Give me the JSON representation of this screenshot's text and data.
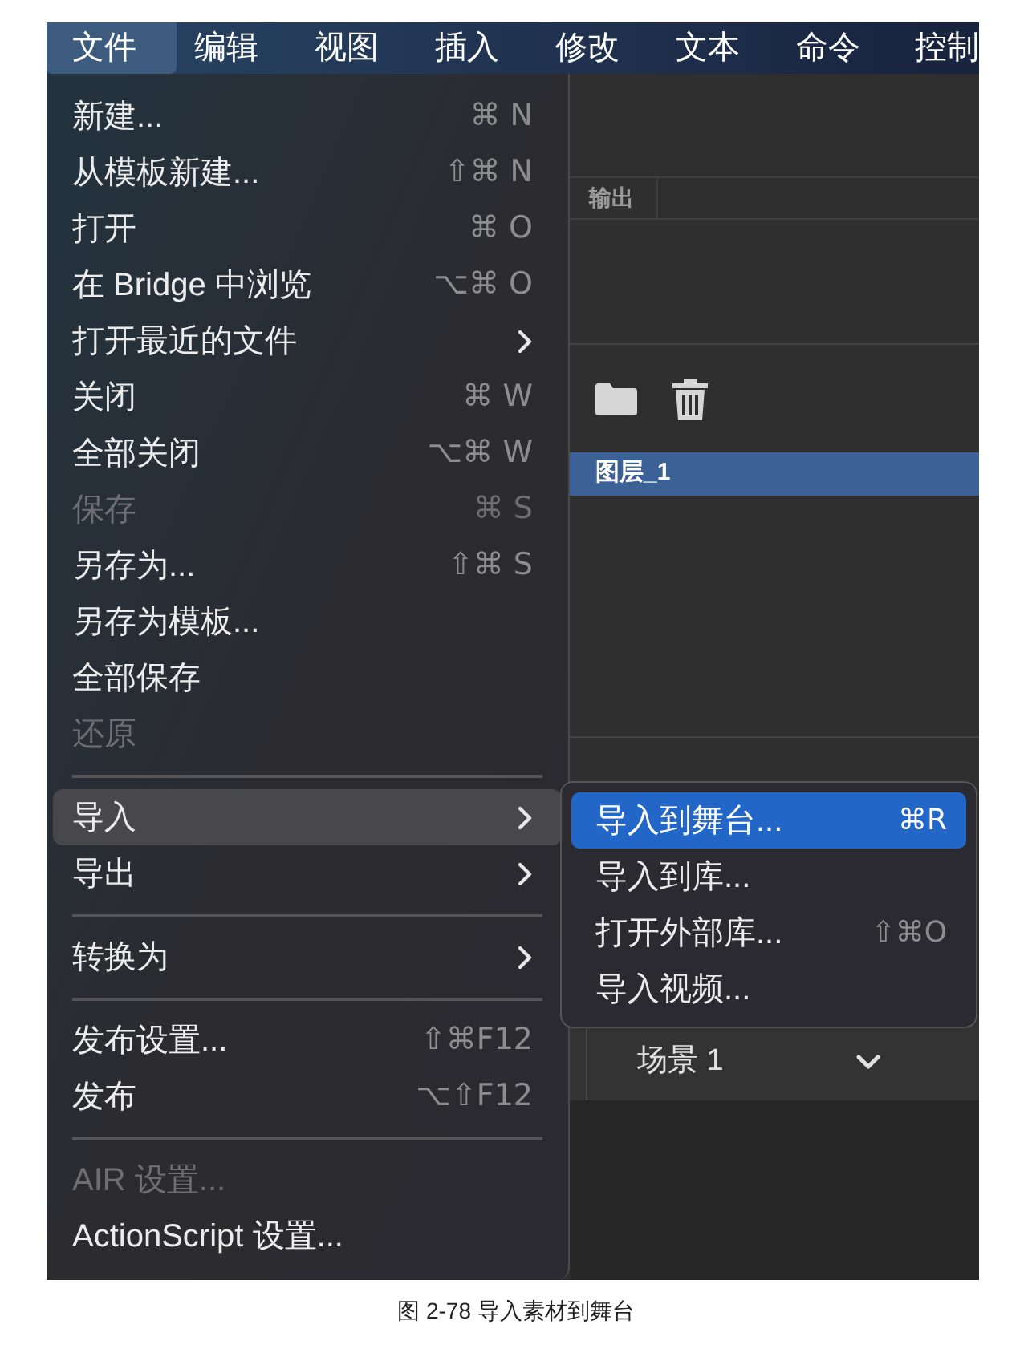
{
  "menu_bar": [
    {
      "label": "文件",
      "selected": true
    },
    {
      "label": "编辑",
      "selected": false
    },
    {
      "label": "视图",
      "selected": false
    },
    {
      "label": "插入",
      "selected": false
    },
    {
      "label": "修改",
      "selected": false
    },
    {
      "label": "文本",
      "selected": false
    },
    {
      "label": "命令",
      "selected": false
    },
    {
      "label": "控制",
      "selected": false
    }
  ],
  "file_menu": {
    "groups": [
      [
        {
          "label": "新建...",
          "shortcut": "⌘ N",
          "disabled": false,
          "selected": false,
          "has_submenu": false
        },
        {
          "label": "从模板新建...",
          "shortcut": "⇧⌘ N",
          "disabled": false,
          "selected": false,
          "has_submenu": false
        },
        {
          "label": "打开",
          "shortcut": "⌘ O",
          "disabled": false,
          "selected": false,
          "has_submenu": false
        },
        {
          "label": "在 Bridge 中浏览",
          "shortcut": "⌥⌘ O",
          "disabled": false,
          "selected": false,
          "has_submenu": false
        },
        {
          "label": "打开最近的文件",
          "disabled": false,
          "selected": false,
          "has_submenu": true
        },
        {
          "label": "关闭",
          "shortcut": "⌘ W",
          "disabled": false,
          "selected": false,
          "has_submenu": false
        },
        {
          "label": "全部关闭",
          "shortcut": "⌥⌘ W",
          "disabled": false,
          "selected": false,
          "has_submenu": false
        },
        {
          "label": "保存",
          "shortcut": "⌘ S",
          "disabled": true,
          "selected": false,
          "has_submenu": false
        },
        {
          "label": "另存为...",
          "shortcut": "⇧⌘ S",
          "disabled": false,
          "selected": false,
          "has_submenu": false
        },
        {
          "label": "另存为模板...",
          "disabled": false,
          "selected": false,
          "has_submenu": false
        },
        {
          "label": "全部保存",
          "disabled": false,
          "selected": false,
          "has_submenu": false
        },
        {
          "label": "还原",
          "disabled": true,
          "selected": false,
          "has_submenu": false
        }
      ],
      [
        {
          "label": "导入",
          "disabled": false,
          "selected": true,
          "has_submenu": true
        },
        {
          "label": "导出",
          "disabled": false,
          "selected": false,
          "has_submenu": true
        }
      ],
      [
        {
          "label": "转换为",
          "disabled": false,
          "selected": false,
          "has_submenu": true
        }
      ],
      [
        {
          "label": "发布设置...",
          "shortcut": "⇧⌘F12",
          "disabled": false,
          "selected": false,
          "has_submenu": false
        },
        {
          "label": "发布",
          "shortcut": "⌥⇧F12",
          "disabled": false,
          "selected": false,
          "has_submenu": false
        }
      ],
      [
        {
          "label": "AIR 设置...",
          "disabled": true,
          "selected": false,
          "has_submenu": false
        },
        {
          "label": "ActionScript 设置...",
          "disabled": false,
          "selected": false,
          "has_submenu": false
        }
      ]
    ]
  },
  "import_submenu": [
    {
      "label": "导入到舞台...",
      "shortcut": "⌘R",
      "selected": true
    },
    {
      "label": "导入到库...",
      "selected": false
    },
    {
      "label": "打开外部库...",
      "shortcut": "⇧⌘O",
      "selected": false
    },
    {
      "label": "导入视频...",
      "selected": false
    }
  ],
  "panel": {
    "tab": "输出",
    "layer": {
      "label": "图层_1",
      "selected": true
    },
    "scene": "场景 1"
  },
  "caption": "图 2-78 导入素材到舞台"
}
